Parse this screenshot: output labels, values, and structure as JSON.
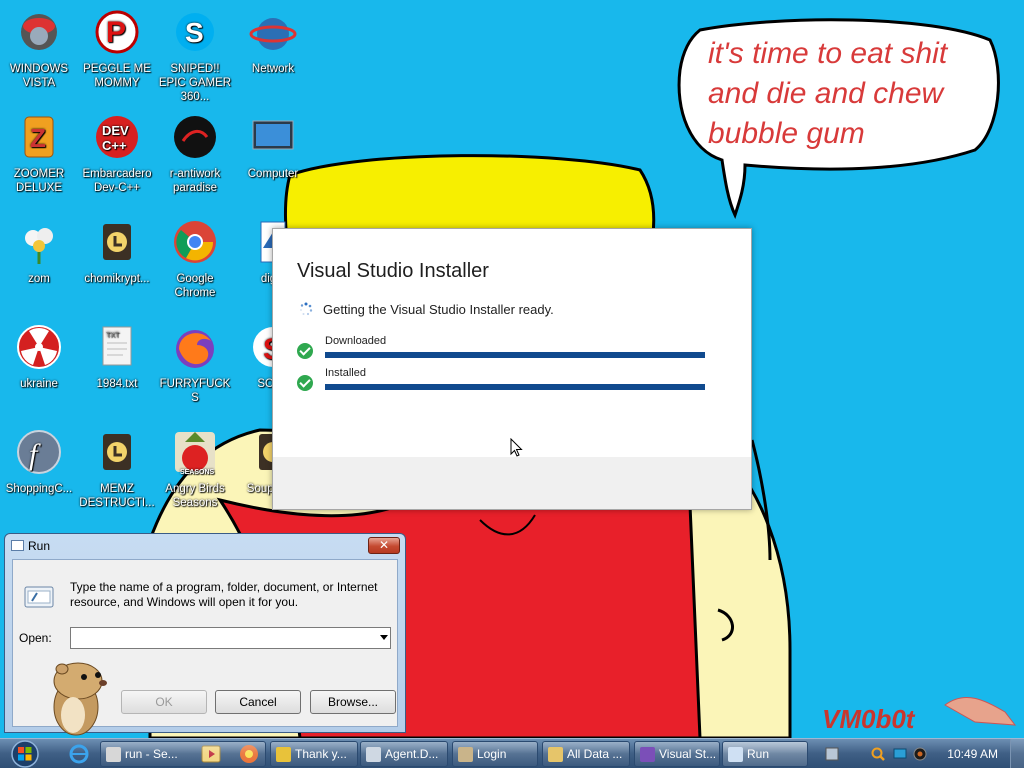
{
  "desktop": {
    "icons": [
      {
        "label": "WINDOWS VISTA"
      },
      {
        "label": "PEGGLE ME MOMMY"
      },
      {
        "label": "SNIPED!! EPIC GAMER 360..."
      },
      {
        "label": "Network"
      },
      {
        "label": "ZOOMER DELUXE"
      },
      {
        "label": "Embarcadero Dev-C++"
      },
      {
        "label": "r-antiwork paradise"
      },
      {
        "label": "Computer"
      },
      {
        "label": "zom"
      },
      {
        "label": "chomikrypt..."
      },
      {
        "label": "Google Chrome"
      },
      {
        "label": "digib"
      },
      {
        "label": "ukraine"
      },
      {
        "label": "1984.txt"
      },
      {
        "label": "FURRYFUCKS"
      },
      {
        "label": "SOYT"
      },
      {
        "label": "ShoppingC..."
      },
      {
        "label": "MEMZ DESTRUCTI..."
      },
      {
        "label": "Angry Birds Seasons"
      },
      {
        "label": "Soup Play"
      }
    ]
  },
  "wallpaper": {
    "speech_bubble": [
      "it's time to eat shit",
      "and die and chew",
      "bubble gum"
    ],
    "signature": "VM0b0t"
  },
  "vs_installer": {
    "title": "Visual Studio Installer",
    "status": "Getting the Visual Studio Installer ready.",
    "steps": [
      {
        "label": "Downloaded",
        "progress": 1.0
      },
      {
        "label": "Installed",
        "progress": 1.0
      }
    ]
  },
  "run_dialog": {
    "title": "Run",
    "close_label": "✕",
    "description": "Type the name of a program, folder, document, or Internet resource, and Windows will open it for you.",
    "open_label": "Open:",
    "open_value": "",
    "ok_label": "OK",
    "cancel_label": "Cancel",
    "browse_label": "Browse..."
  },
  "taskbar": {
    "tasks": [
      {
        "label": "run - Se...",
        "icon_color": "#d7d7d7"
      },
      {
        "label": "Thank y...",
        "icon_color": "#e8c23a"
      },
      {
        "label": "Agent.D...",
        "icon_color": "#cfd8e3"
      },
      {
        "label": "Login",
        "icon_color": "#c9b48a"
      },
      {
        "label": "All Data ...",
        "icon_color": "#e6c56a"
      },
      {
        "label": "Visual St...",
        "icon_color": "#7b4fb8"
      },
      {
        "label": "Run",
        "icon_color": "#cfe0f3"
      }
    ],
    "clock": "10:49 AM"
  },
  "colors": {
    "desktop_bg": "#18b8ec",
    "vs_progress": "#104a8e",
    "vs_check": "#2fa84f"
  }
}
